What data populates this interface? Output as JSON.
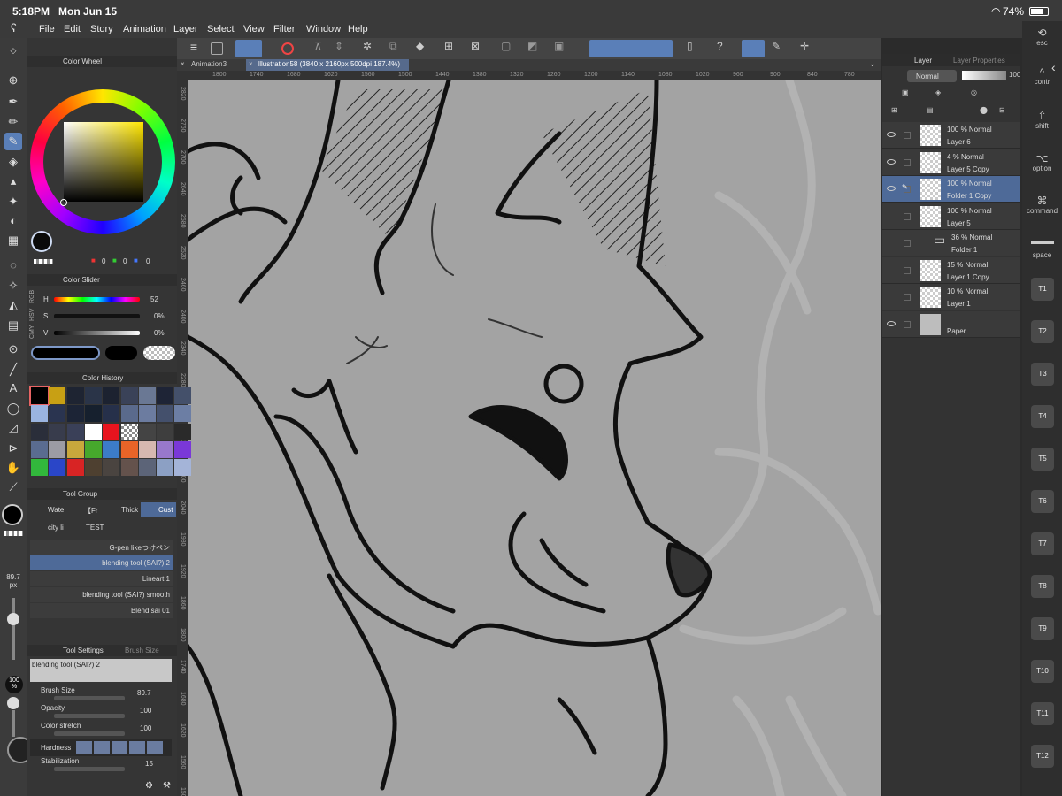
{
  "status": {
    "time": "5:18PM",
    "date": "Mon Jun 15",
    "battery": "74%"
  },
  "menu": [
    "File",
    "Edit",
    "Story",
    "Animation",
    "Layer",
    "Select",
    "View",
    "Filter",
    "Window",
    "Help"
  ],
  "tabs": [
    {
      "label": "Animation3"
    },
    {
      "label": "Illustration58 (3840 x 2160px 500dpi 187.4%)"
    }
  ],
  "ruler": {
    "h": [
      "1800",
      "1740",
      "1680",
      "1620",
      "1560",
      "1500",
      "1440",
      "1380",
      "1320",
      "1260",
      "1200",
      "1140",
      "1080",
      "1020",
      "960",
      "900",
      "840",
      "780"
    ],
    "v": [
      "2820",
      "2760",
      "2700",
      "2640",
      "2580",
      "2520",
      "2460",
      "2400",
      "2340",
      "2280",
      "2220",
      "2160",
      "2100",
      "2040",
      "1980",
      "1920",
      "1860",
      "1800",
      "1740",
      "1680",
      "1620",
      "1560",
      "1500"
    ]
  },
  "color_wheel": {
    "title": "Color Wheel",
    "values": [
      "0",
      "0",
      "0"
    ],
    "main_color": "#0a0a0a"
  },
  "color_slider": {
    "title": "Color Slider",
    "modes": [
      "RGB",
      "HSV",
      "CMY"
    ],
    "h": {
      "label": "H",
      "value": "52"
    },
    "s": {
      "label": "S",
      "value": "0%"
    },
    "v": {
      "label": "V",
      "value": "0%"
    }
  },
  "color_history": {
    "title": "Color History",
    "swatches": [
      "#000000",
      "#c8a014",
      "#1e2432",
      "#2a3448",
      "#1c2230",
      "#3a4258",
      "#6a7894",
      "#1e2436",
      "#44506a",
      "#9ab4e0",
      "#2a3450",
      "#1c2436",
      "#16202e",
      "#26304a",
      "#5a6a8c",
      "#6c7ca0",
      "#44506c",
      "#6c7ea4",
      "#2a2e3a",
      "#383c4c",
      "#3a4058",
      "#ffffff",
      "#e8141e",
      "checker",
      "#444",
      "#3e3e3e",
      "#2a2a2a",
      "#5a6c90",
      "#9c9ca4",
      "#c8a83c",
      "#46a82c",
      "#3c7cc8",
      "#e86428",
      "#d6b8b0",
      "#9878cc",
      "#7a38d8",
      "#32b83c",
      "#2a46c8",
      "#d82424",
      "#4e4030",
      "#4a4440",
      "#64524c",
      "#5c6478",
      "#8ca0c4",
      "#a4b4d8"
    ]
  },
  "tool_group": {
    "title": "Tool Group",
    "tabs": [
      "Wate",
      "【Fr",
      "Thick",
      "Cust"
    ],
    "sub_tabs": [
      "city li",
      "TEST"
    ],
    "brushes": [
      "G-pen likeつけペン",
      "blending tool (SAI?) 2",
      "Lineart 1",
      "blending tool (SAI?) smooth",
      "Blend sai 01"
    ]
  },
  "tool_settings": {
    "title": "Tool Settings",
    "tab2": "Brush Size",
    "brush_name": "blending tool (SAI?) 2",
    "brush_size": {
      "label": "Brush Size",
      "value": "89.7"
    },
    "opacity": {
      "label": "Opacity",
      "value": "100"
    },
    "color_stretch": {
      "label": "Color stretch",
      "value": "100"
    },
    "hardness": {
      "label": "Hardness"
    },
    "stabilization": {
      "label": "Stabilization",
      "value": "15"
    }
  },
  "left_strip": {
    "size": "89.7",
    "size_unit": "px",
    "opacity": "100",
    "opacity_unit": "%"
  },
  "layer_panel": {
    "tabs": [
      "Layer",
      "Layer Properties"
    ],
    "blend_mode": "Normal",
    "opacity": "100",
    "layers": [
      {
        "opacity": "100 %",
        "mode": "Normal",
        "name": "Layer 6",
        "visible": true,
        "selected": false
      },
      {
        "opacity": "4 %",
        "mode": "Normal",
        "name": "Layer 5 Copy",
        "visible": true,
        "selected": false
      },
      {
        "opacity": "100 %",
        "mode": "Normal",
        "name": "Folder 1 Copy",
        "visible": true,
        "selected": true
      },
      {
        "opacity": "100 %",
        "mode": "Normal",
        "name": "Layer 5",
        "visible": false,
        "selected": false
      },
      {
        "opacity": "36 %",
        "mode": "Normal",
        "name": "Folder 1",
        "visible": false,
        "selected": false,
        "folder": true
      },
      {
        "opacity": "15 %",
        "mode": "Normal",
        "name": "Layer 1 Copy",
        "visible": false,
        "selected": false
      },
      {
        "opacity": "10 %",
        "mode": "Normal",
        "name": "Layer 1",
        "visible": false,
        "selected": false
      },
      {
        "opacity": "",
        "mode": "",
        "name": "Paper",
        "visible": true,
        "selected": false,
        "paper": true
      }
    ]
  },
  "keyboard": {
    "esc": "esc",
    "ctrl": "contr",
    "shift": "shift",
    "option": "option",
    "command": "command",
    "space": "space",
    "tkeys": [
      "T1",
      "T2",
      "T3",
      "T4",
      "T5",
      "T6",
      "T7",
      "T8",
      "T9",
      "T10",
      "T11",
      "T12"
    ]
  }
}
